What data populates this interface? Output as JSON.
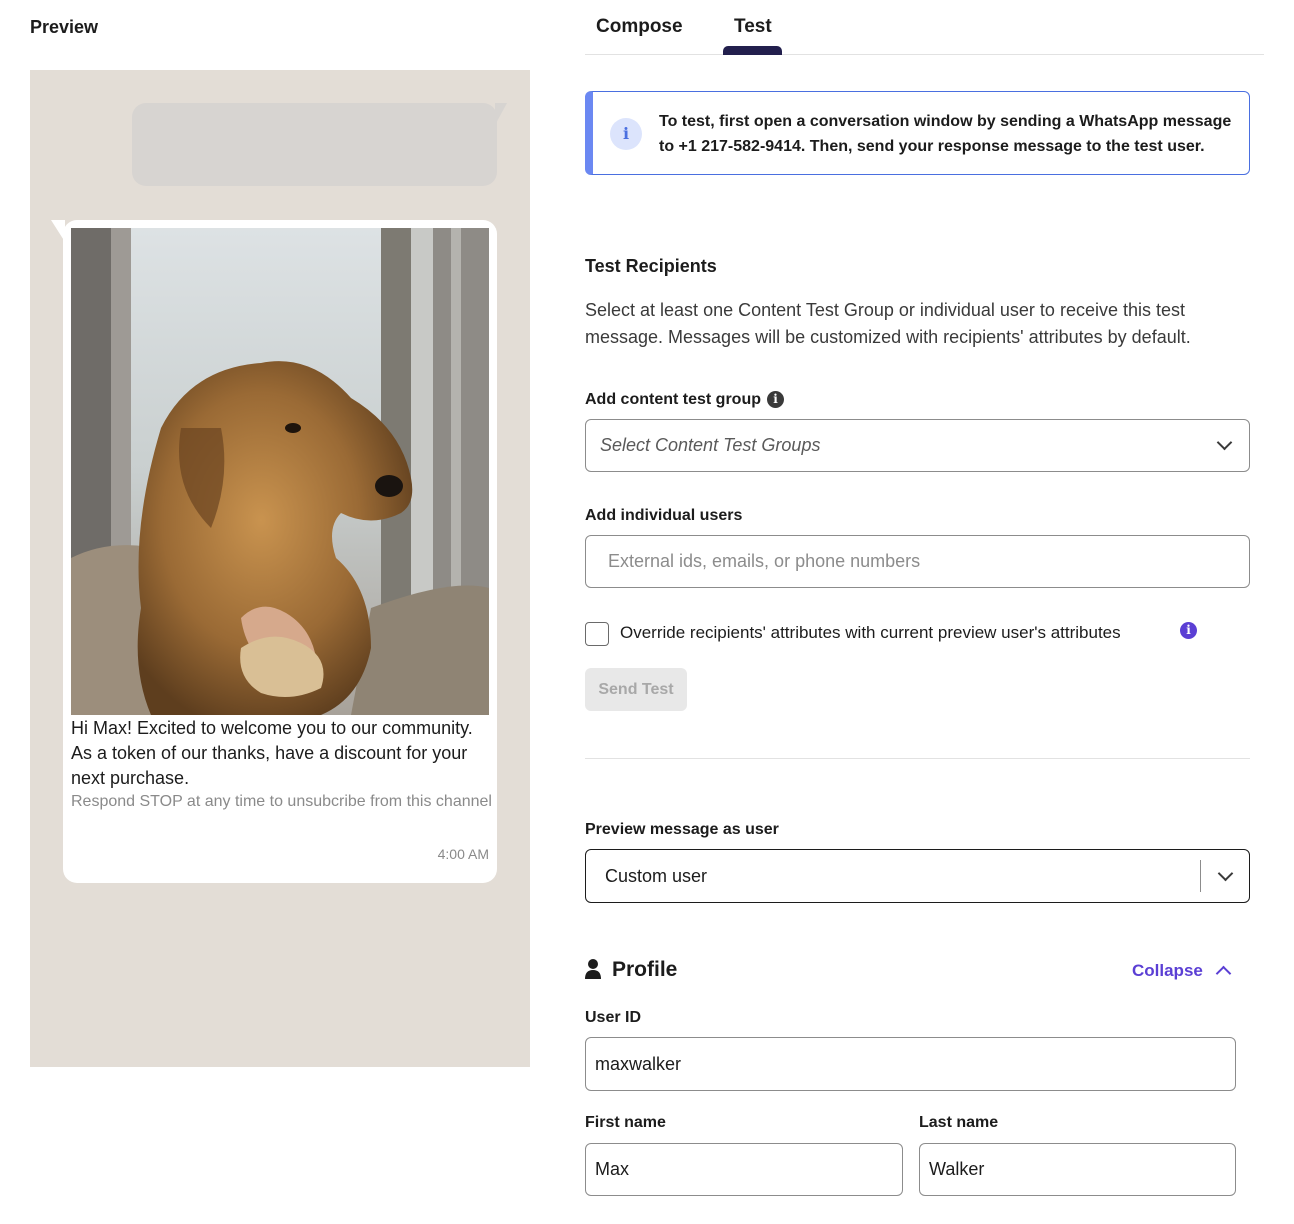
{
  "preview": {
    "title": "Preview",
    "message": {
      "image_alt": "Golden retriever dog resting on a person's hand on a couch",
      "body": "Hi Max! Excited to welcome you to our community. As a token of our thanks, have a discount for your next purchase.",
      "footer": "Respond STOP at any time to unsubcribe from this channel",
      "time": "4:00 AM"
    }
  },
  "tabs": [
    {
      "label": "Compose",
      "active": false
    },
    {
      "label": "Test",
      "active": true
    }
  ],
  "info_banner": {
    "icon": "info-icon",
    "text": "To test, first open a conversation window by sending a WhatsApp message to +1 217-582-9414. Then, send your response message to the test user."
  },
  "test_recipients": {
    "title": "Test Recipients",
    "description": "Select at least one Content Test Group or individual user to receive this test message. Messages will be customized with recipients' attributes by default.",
    "content_group_label": "Add content test group",
    "content_group_placeholder": "Select Content Test Groups",
    "individual_users_label": "Add individual users",
    "individual_users_placeholder": "External ids, emails, or phone numbers",
    "override_label": "Override recipients' attributes with current preview user's attributes",
    "override_checked": false,
    "send_button": "Send Test"
  },
  "preview_as": {
    "label": "Preview message as user",
    "value": "Custom user"
  },
  "profile": {
    "title": "Profile",
    "collapse_label": "Collapse",
    "user_id_label": "User ID",
    "user_id_value": "maxwalker",
    "first_name_label": "First name",
    "first_name_value": "Max",
    "last_name_label": "Last name",
    "last_name_value": "Walker"
  },
  "colors": {
    "accent": "#5b3fd4",
    "info_border": "#4a6fe0",
    "tab_indicator": "#221f4d",
    "phone_background": "#e3ddd6"
  }
}
